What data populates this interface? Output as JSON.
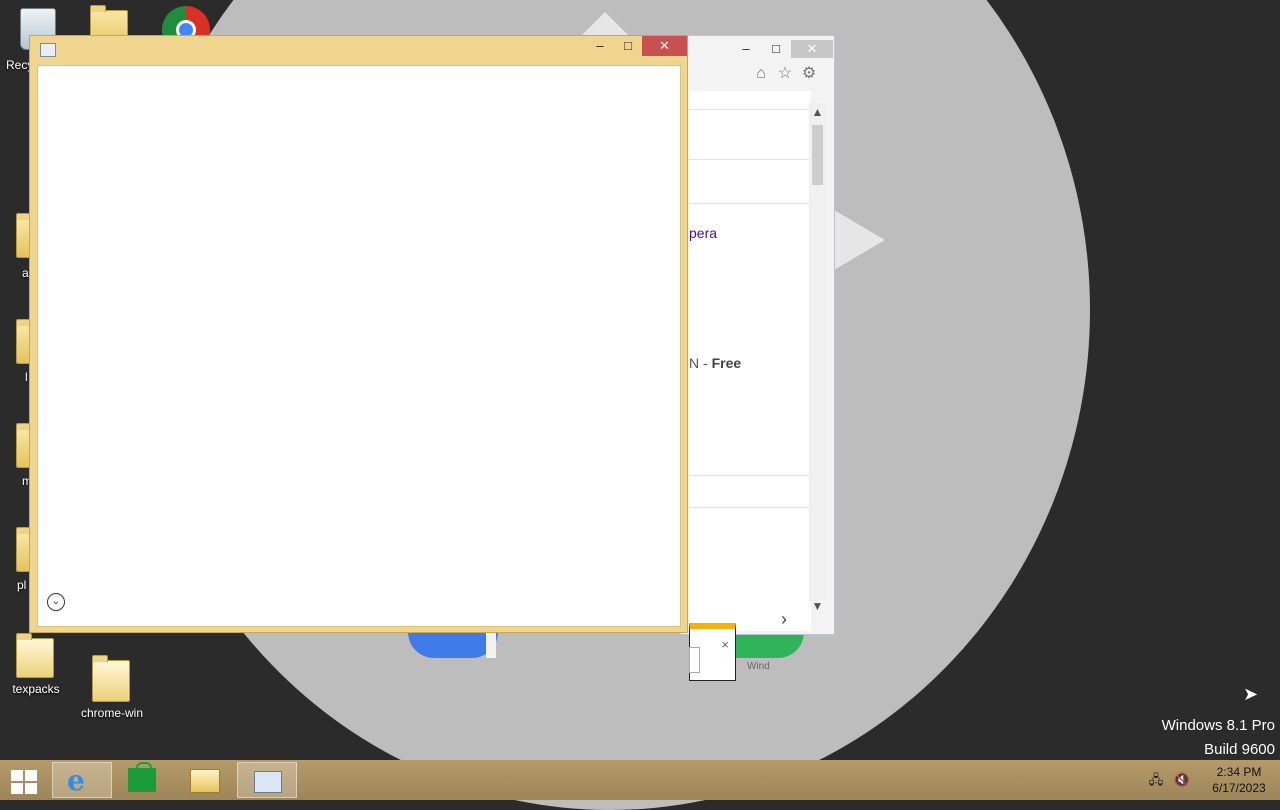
{
  "desktop": {
    "icons": [
      {
        "label": "Recy",
        "icon": "recycle-bin-icon"
      },
      {
        "label": "",
        "icon": "folder-icon"
      },
      {
        "label": "",
        "icon": "chrome-icon"
      },
      {
        "label": "a",
        "icon": "folder-icon"
      },
      {
        "label": "l",
        "icon": "folder-icon"
      },
      {
        "label": "m",
        "icon": "folder-icon"
      },
      {
        "label": "pl",
        "icon": "folder-icon"
      },
      {
        "label": "texpacks",
        "icon": "folder-icon"
      },
      {
        "label": "chrome-win",
        "icon": "folder-icon"
      }
    ]
  },
  "ie_window": {
    "controls": {
      "minimize": "–",
      "maximize": "□",
      "close": "✕"
    },
    "toolbar": {
      "home": "⌂",
      "favorites": "☆",
      "settings": "⚙"
    },
    "content_text_1": "pera",
    "content_text_2_prefix": "N - ",
    "content_text_2_bold": "Free",
    "partial_text": "Wind",
    "popup_close": "×",
    "scroll_up": "▲",
    "scroll_down": "▼",
    "next_arrow": "›"
  },
  "app_window": {
    "controls": {
      "minimize": "–",
      "maximize": "□",
      "close": "✕"
    },
    "expand_glyph": "⌄"
  },
  "watermark": {
    "line1": "Windows 8.1 Pro",
    "line2": "Build 9600"
  },
  "taskbar": {
    "items": [
      {
        "name": "start",
        "icon": "windows-logo-icon"
      },
      {
        "name": "internet-explorer",
        "icon": "ie-icon"
      },
      {
        "name": "store",
        "icon": "store-icon"
      },
      {
        "name": "file-explorer",
        "icon": "folder-icon"
      },
      {
        "name": "resource-monitor",
        "icon": "performance-monitor-icon"
      }
    ],
    "ie_glyph": "e",
    "tray": {
      "network": "🖧",
      "volume": "🔇"
    },
    "clock": {
      "time": "2:34 PM",
      "date": "6/17/2023"
    }
  },
  "colors": {
    "window_frame": "#f0d58e",
    "close_button": "#c75050",
    "taskbar": "#b59b6a"
  }
}
